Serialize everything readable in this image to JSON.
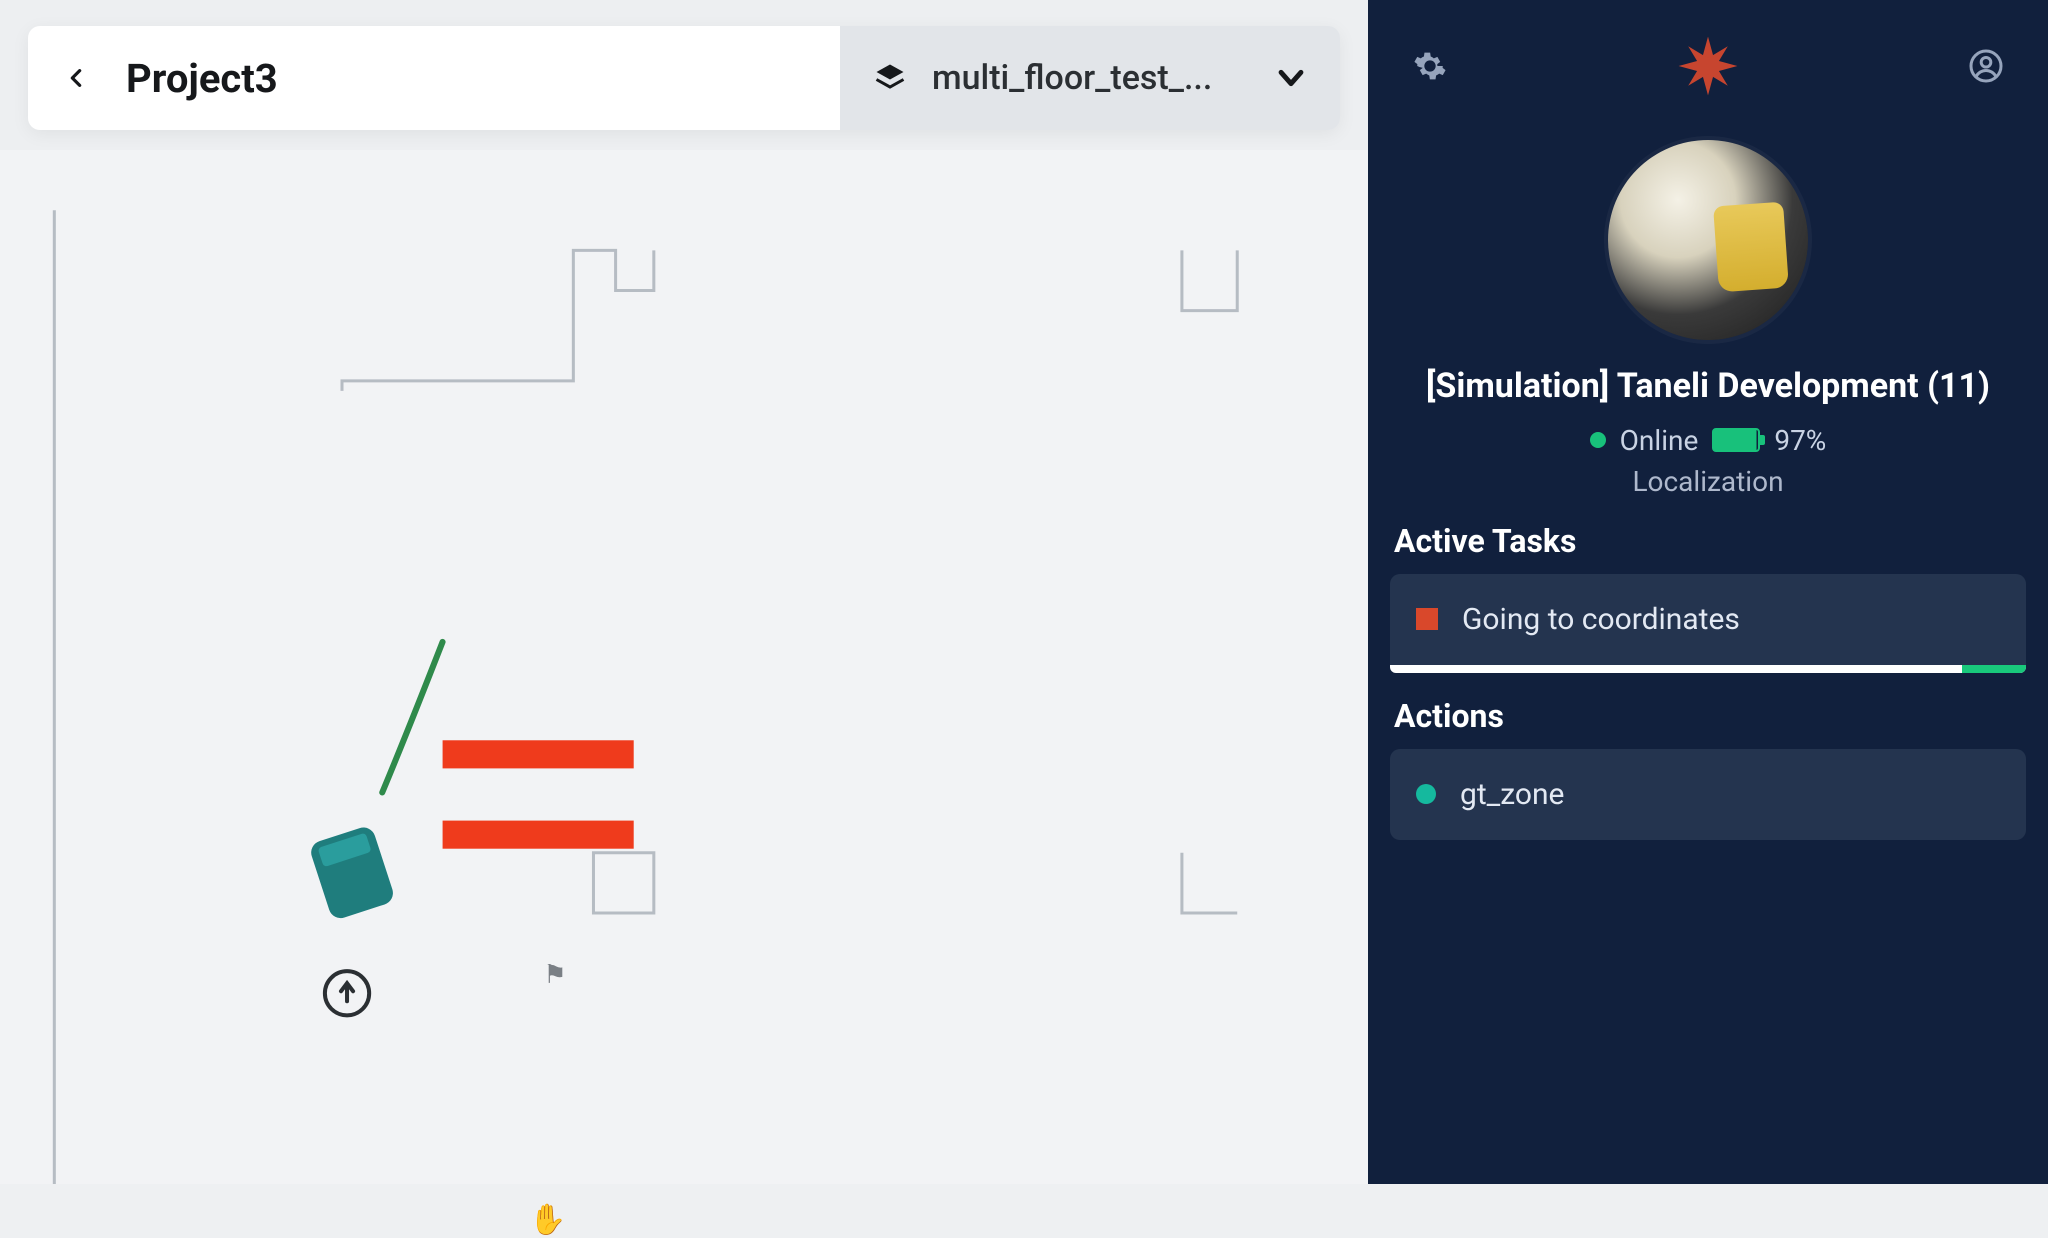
{
  "header": {
    "project_title": "Project3",
    "floor_selector_label": "multi_floor_test_..."
  },
  "panel": {
    "robot_name": "[Simulation] Taneli Development (11)",
    "status_text": "Online",
    "battery_pct": "97%",
    "localization_label": "Localization",
    "active_tasks_title": "Active Tasks",
    "tasks": [
      {
        "label": "Going to coordinates",
        "color": "#d9482b"
      }
    ],
    "actions_title": "Actions",
    "actions": [
      {
        "label": "gt_zone",
        "color": "#15b99e"
      }
    ]
  },
  "colors": {
    "panel_bg": "#11203d",
    "card_bg": "#24344f",
    "accent_green": "#18c17b",
    "obstacle_red": "#ee3b1c",
    "robot_teal": "#1f7d7d"
  }
}
